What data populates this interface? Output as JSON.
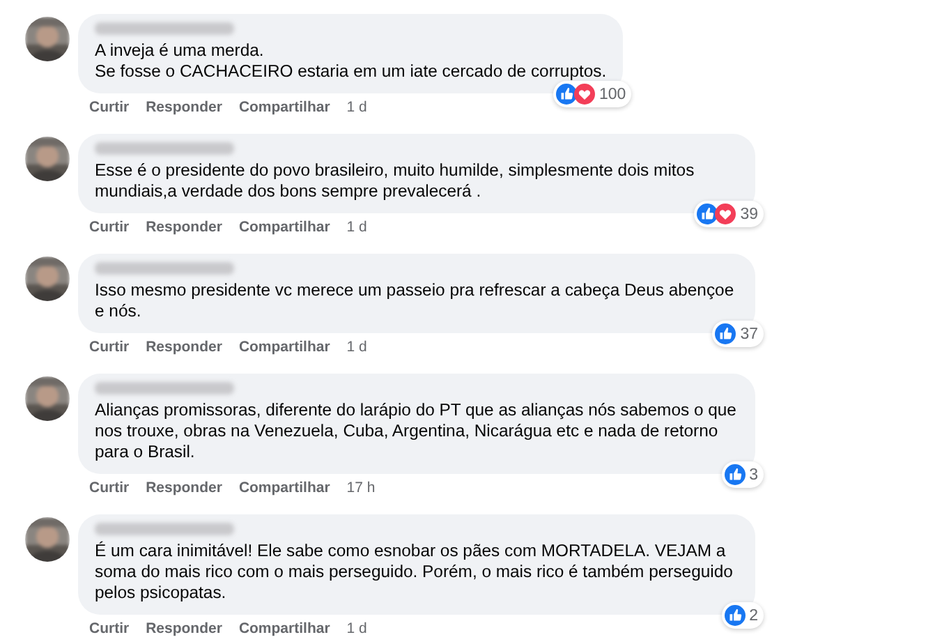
{
  "comments": [
    {
      "text": "A inveja é uma merda.\nSe fosse o CACHACEIRO estaria em um iate cercado de corruptos.",
      "actions": [
        "Curtir",
        "Responder",
        "Compartilhar"
      ],
      "time": "1 d",
      "reactions": [
        {
          "kind": "like"
        },
        {
          "kind": "love"
        }
      ],
      "reaction_count": "100"
    },
    {
      "text": "Esse é o presidente do povo brasileiro, muito humilde, simplesmente dois mitos mundiais,a verdade dos bons sempre prevalecerá .",
      "actions": [
        "Curtir",
        "Responder",
        "Compartilhar"
      ],
      "time": "1 d",
      "reactions": [
        {
          "kind": "like"
        },
        {
          "kind": "love"
        }
      ],
      "reaction_count": "39"
    },
    {
      "text": "Isso mesmo presidente vc merece um passeio pra refrescar a cabeça Deus abençoe e nós.",
      "actions": [
        "Curtir",
        "Responder",
        "Compartilhar"
      ],
      "time": "1 d",
      "reactions": [
        {
          "kind": "like"
        }
      ],
      "reaction_count": "37"
    },
    {
      "text": "Alianças promissoras, diferente do larápio do PT que as alianças nós sabemos o que nos trouxe, obras na Venezuela, Cuba, Argentina, Nicarágua etc e nada de retorno para o Brasil.",
      "actions": [
        "Curtir",
        "Responder",
        "Compartilhar"
      ],
      "time": "17 h",
      "reactions": [
        {
          "kind": "like"
        }
      ],
      "reaction_count": "3"
    },
    {
      "text": "É um cara inimitável! Ele sabe como esnobar os pães com MORTADELA. VEJAM a soma do mais rico com o mais perseguido. Porém, o mais rico é também perseguido pelos psicopatas.",
      "actions": [
        "Curtir",
        "Responder",
        "Compartilhar"
      ],
      "time": "1 d",
      "reactions": [
        {
          "kind": "like"
        }
      ],
      "reaction_count": "2"
    }
  ]
}
